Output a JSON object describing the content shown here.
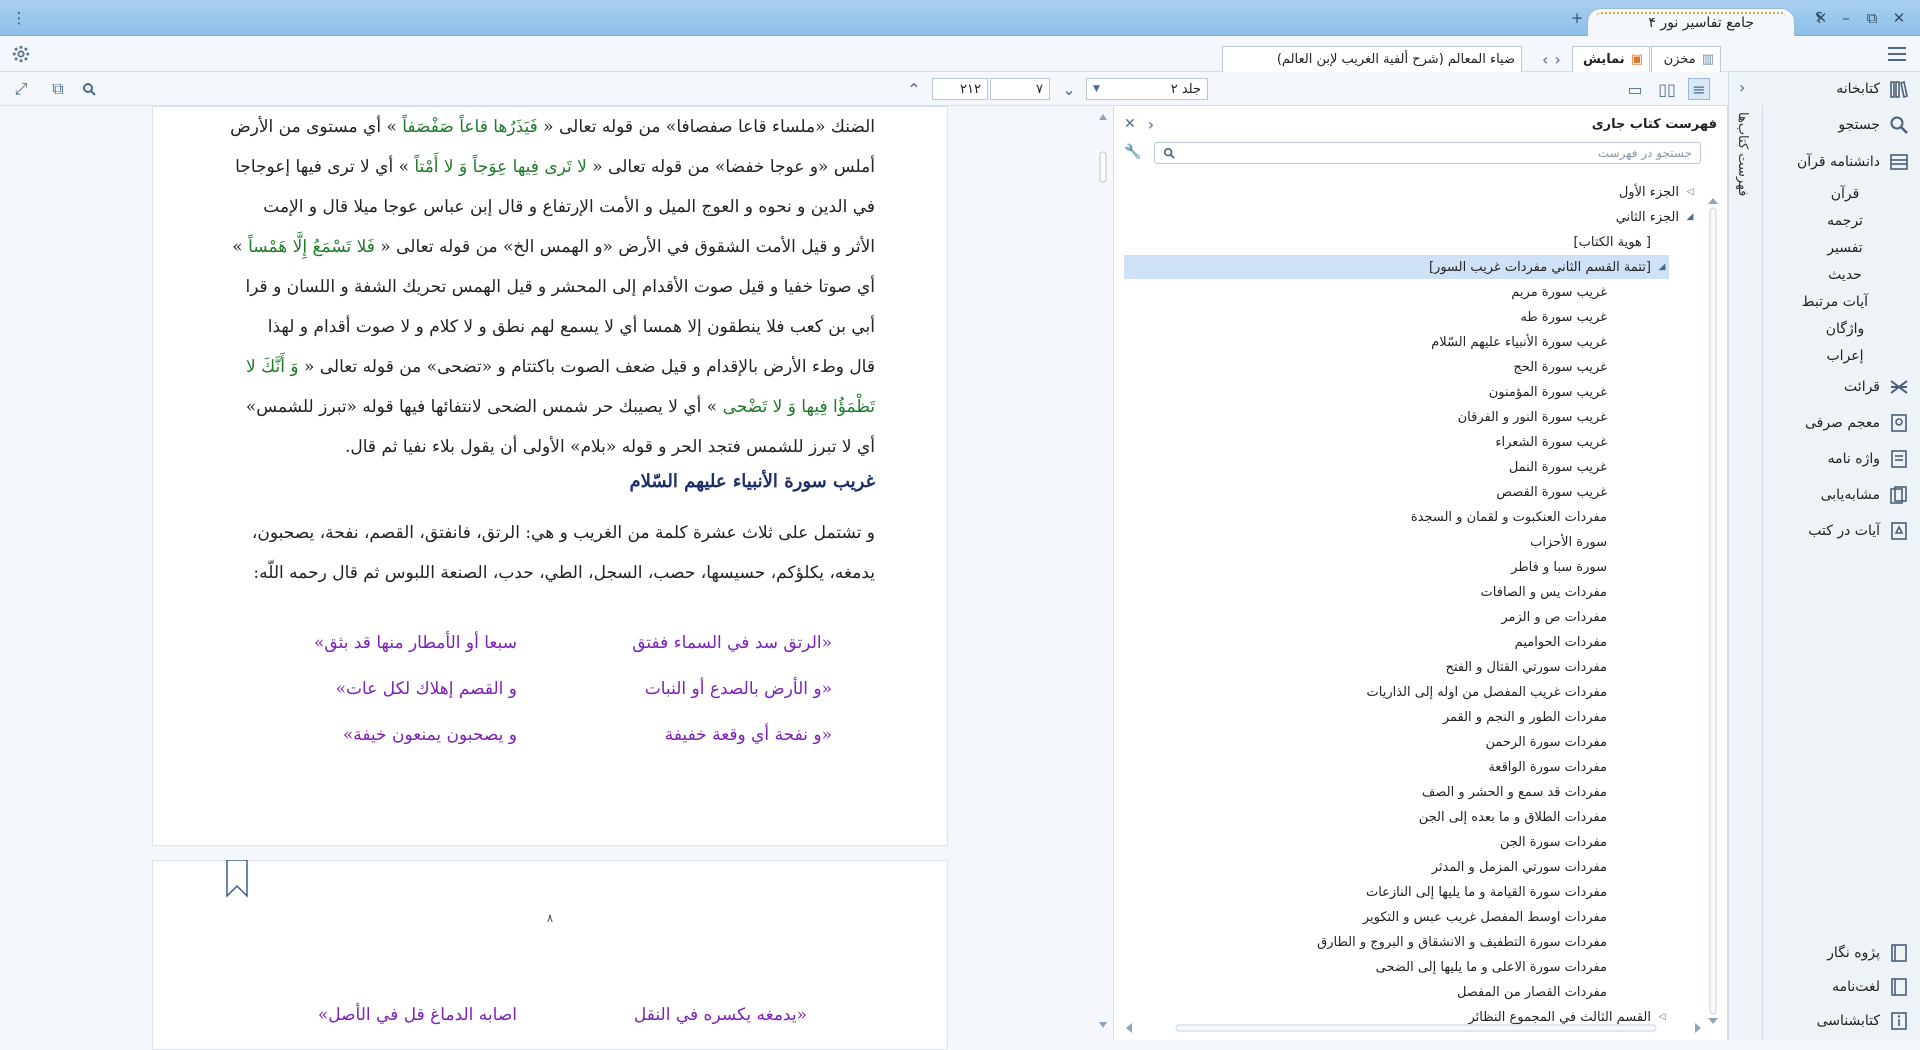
{
  "window": {
    "title": "جامع تفاسیر نور ۴",
    "buttons": {
      "help": "؟",
      "minimize": "–",
      "restore": "⧉",
      "close": "✕",
      "add_tab": "+"
    }
  },
  "tabs": {
    "storage": "مخزن",
    "display": "نمایش",
    "book": "ضياء المعالم (شرح ألفية الغريب لإبن العالم)"
  },
  "nav": {
    "volume": "جلد ۲",
    "page": "۷",
    "total_pages": "۲۱۲"
  },
  "sidebar": {
    "items": [
      {
        "label": "کتابخانه",
        "icon": "library-icon"
      },
      {
        "label": "جستجو",
        "icon": "search-icon"
      },
      {
        "label": "دانشنامه قرآن",
        "icon": "encyclopedia-icon"
      }
    ],
    "sub_items": [
      "قرآن",
      "ترجمه",
      "تفسير",
      "حديث",
      "آيات مرتبط",
      "واژگان",
      "إعراب"
    ],
    "items2": [
      {
        "label": "قرائت",
        "icon": "cross-icon"
      },
      {
        "label": "معجم صرفی",
        "icon": "dictionary-icon"
      },
      {
        "label": "واژه نامه",
        "icon": "wordbook-icon"
      },
      {
        "label": "مشابه‌یابی",
        "icon": "similar-icon"
      },
      {
        "label": "آيات در كتب",
        "icon": "verses-icon"
      }
    ],
    "bottom": [
      "پژوه نگار",
      "لغت‌نامه",
      "کتابشناسی"
    ]
  },
  "vertical_strip": {
    "label": "فهرست کتاب‌ها"
  },
  "toc": {
    "title": "فهرست كتاب جاری",
    "search_placeholder": "جستجو در فهرست",
    "entries": [
      {
        "text": "الجزء الأول",
        "level": 0,
        "arrow": "◁"
      },
      {
        "text": "الجزء الثاني",
        "level": 0,
        "arrow": "◢"
      },
      {
        "text": "[ هوية الكتاب]",
        "level": 1,
        "arrow": ""
      },
      {
        "text": "[تتمة القسم الثاني مفردات غريب السور]",
        "level": 1,
        "arrow": "◢",
        "selected": true
      },
      {
        "text": "غريب سورة مريم",
        "level": 2
      },
      {
        "text": "غريب سورة طه",
        "level": 2
      },
      {
        "text": "غريب سورة الأنبياء عليهم السّلام",
        "level": 2
      },
      {
        "text": "غريب سورة الحج",
        "level": 2
      },
      {
        "text": "غريب سورة المؤمنون",
        "level": 2
      },
      {
        "text": "غريب سورة النور و الفرقان",
        "level": 2
      },
      {
        "text": "غريب سورة الشعراء",
        "level": 2
      },
      {
        "text": "غريب سورة النمل",
        "level": 2
      },
      {
        "text": "غريب سورة القصص",
        "level": 2
      },
      {
        "text": "مفردات العنكبوت و لقمان و السجدة",
        "level": 2
      },
      {
        "text": "سورة الأحزاب",
        "level": 2
      },
      {
        "text": "سورة سبا و فاطر",
        "level": 2
      },
      {
        "text": "مفردات يس و الصافات",
        "level": 2
      },
      {
        "text": "مفردات ص و الزمر",
        "level": 2
      },
      {
        "text": "مفردات الحواميم",
        "level": 2
      },
      {
        "text": "مفردات سورتي القتال و الفتح",
        "level": 2
      },
      {
        "text": "مفردات غريب المفصل من اوله إلى الذاريات",
        "level": 2
      },
      {
        "text": "مفردات الطور و النجم و القمر",
        "level": 2
      },
      {
        "text": "مفردات سورة الرحمن",
        "level": 2
      },
      {
        "text": "مفردات سورة الواقعة",
        "level": 2
      },
      {
        "text": "مفردات قد سمع و الحشر و الصف",
        "level": 2
      },
      {
        "text": "مفردات الطلاق و ما بعده إلى الجن",
        "level": 2
      },
      {
        "text": "مفردات سورة الجن",
        "level": 2
      },
      {
        "text": "مفردات سورتي المزمل و المدثر",
        "level": 2
      },
      {
        "text": "مفردات سورة القيامة و ما يليها إلى النازعات",
        "level": 2
      },
      {
        "text": "مفردات اوسط المفصل غريب عبس و التكوير",
        "level": 2
      },
      {
        "text": "مفردات سورة التطفيف و الانشقاق و البروج و الطارق",
        "level": 2
      },
      {
        "text": "مفردات سورة الاعلى و ما يليها إلى الضحى",
        "level": 2
      },
      {
        "text": "مفردات القصار من المفصل",
        "level": 2
      },
      {
        "text": "القسم الثالث في المجموع النظائر",
        "level": 1,
        "arrow": "◁"
      }
    ]
  },
  "document": {
    "page1": {
      "lines": [
        {
          "parts": [
            {
              "t": "الضنك «ملساء قاعا صفصافا» من قوله تعالى « "
            },
            {
              "t": "فَيَذَرُها قاعاً صَفْصَفاً",
              "q": true
            },
            {
              "t": " » أي مستوى من الأرض"
            }
          ]
        },
        {
          "parts": [
            {
              "t": "أملس «و عوجا خفضا» من قوله تعالى « "
            },
            {
              "t": "لا تَرى‏ فِيها عِوَجاً وَ لا أَمْتاً",
              "q": true
            },
            {
              "t": " » أي لا ترى فيها إعوجاجا"
            }
          ]
        },
        {
          "parts": [
            {
              "t": "في الدين و نحوه و العوج الميل و الأمت الإرتفاع و قال إبن عباس عوجا ميلا قال و الإمت"
            }
          ]
        },
        {
          "parts": [
            {
              "t": "الأثر و قيل الأمت الشقوق في الأرض «و الهمس الخ» من قوله تعالى « "
            },
            {
              "t": "فَلا تَسْمَعُ إِلَّا هَمْساً",
              "q": true
            },
            {
              "t": " »"
            }
          ]
        },
        {
          "parts": [
            {
              "t": "أي صوتا خفيا و قيل صوت الأقدام إلى المحشر و قيل الهمس تحريك الشفة و اللسان و قرا"
            }
          ]
        },
        {
          "parts": [
            {
              "t": "أبي بن كعب فلا ينطقون إلا همسا أي لا يسمع لهم نطق و لا كلام و لا صوت أقدام و لهذا"
            }
          ]
        },
        {
          "parts": [
            {
              "t": "قال وطء الأرض بالإقدام و قيل ضعف الصوت باكتتام و «تضحى» من قوله تعالى « "
            },
            {
              "t": "وَ أَنَّكَ لا",
              "q": true
            }
          ]
        },
        {
          "parts": [
            {
              "t": "تَظْمَؤُا فِيها وَ لا تَضْحى‏",
              "q": true
            },
            {
              "t": " » أي لا يصيبك حر شمس الضحى لانتفائها فيها قوله «تبرز للشمس»"
            }
          ]
        },
        {
          "parts": [
            {
              "t": "أي لا تبرز للشمس فتجد الحر و قوله «بلام» الأولى أن يقول بلاء نفيا ثم قال."
            }
          ]
        }
      ],
      "heading": "غريب سورة الأنبياء عليهم السّلام",
      "intro": [
        "و تشتمل على ثلاث عشرة كلمة من الغريب و هي: الرتق، فانفتق، القصم، نفحة، يصحبون،",
        "يدمغه، يكلؤكم، حسيسها، حصب، السجل، الطي، حدب، الصنعة اللبوس ثم قال رحمه اللّه:"
      ],
      "poem": [
        {
          "right": "«الرتق سد في السماء ففتق",
          "left": "سبعا أو الأمطار منها قد بثق»"
        },
        {
          "right": "«و الأرض بالصدع أو النبات",
          "left": "و القصم إهلاك لكل عات»"
        },
        {
          "right": "«و نفحة أي وقعة خفيفة",
          "left": "و يصحبون يمنعون خيفة»"
        }
      ]
    },
    "page2": {
      "page_number": "۸",
      "poem": [
        {
          "right": "«يدمغه يكسره في النقل",
          "left": "اصابه الدماغ قل في الأصل»"
        }
      ]
    }
  },
  "colors": {
    "accent": "#8ec0ea",
    "selected": "#cfe1f7",
    "quran": "#1f7a2a",
    "poem": "#7d22b8",
    "heading": "#1d2f6b"
  }
}
